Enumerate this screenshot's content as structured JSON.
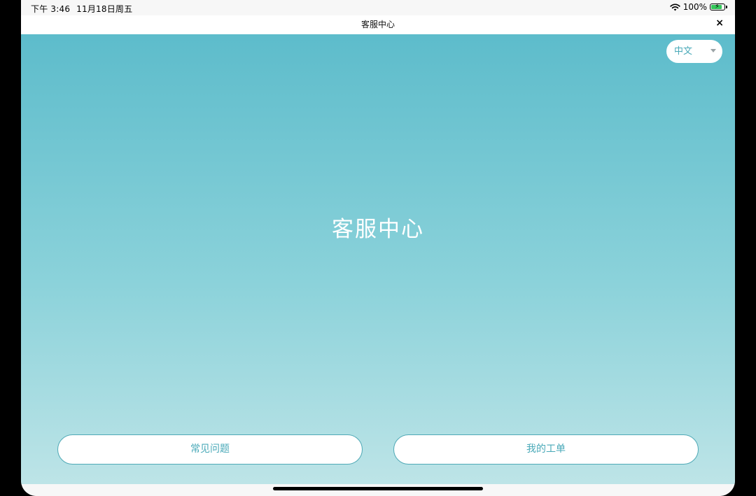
{
  "status_bar": {
    "time": "下午 3:46",
    "date": "11月18日周五",
    "battery_percent": "100%",
    "battery_level": 1.0,
    "icons": [
      "wifi-icon",
      "battery-charging-icon"
    ]
  },
  "nav": {
    "title": "客服中心",
    "close_label": "×"
  },
  "language_select": {
    "selected": "中文"
  },
  "hero": {
    "title": "客服中心"
  },
  "actions": {
    "faq_label": "常见问题",
    "tickets_label": "我的工单"
  },
  "colors": {
    "accent": "#49a9b8",
    "gradient_top": "#5dbccb",
    "gradient_bottom": "#bde4e7"
  }
}
